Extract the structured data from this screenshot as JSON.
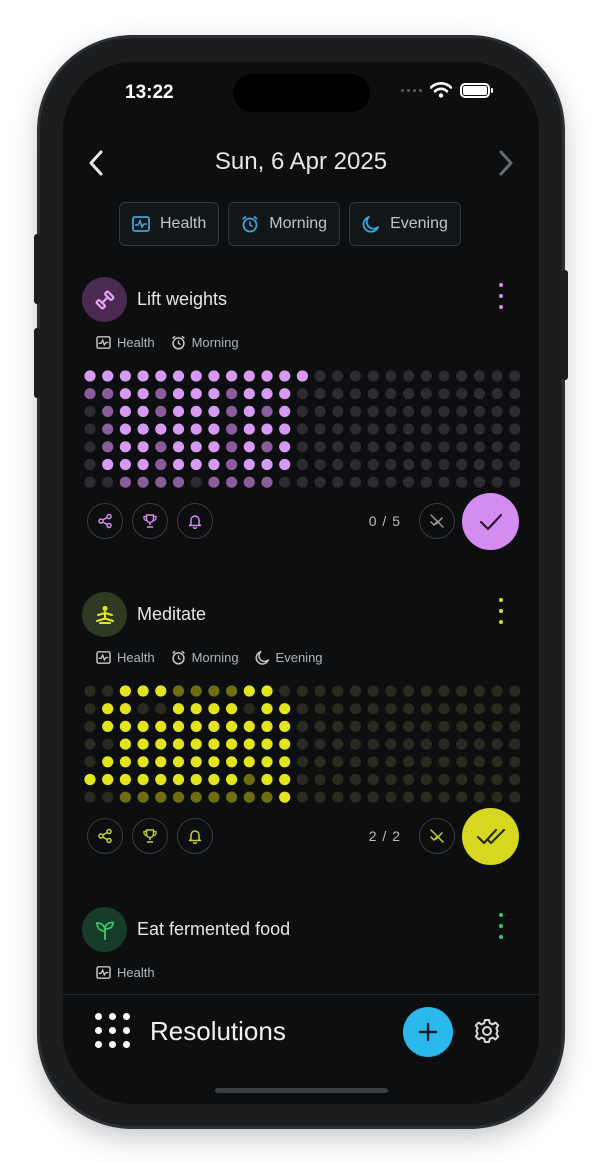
{
  "status": {
    "time": "13:22"
  },
  "header": {
    "date": "Sun, 6 Apr 2025"
  },
  "filters": [
    {
      "label": "Health",
      "icon": "health-icon"
    },
    {
      "label": "Morning",
      "icon": "alarm-icon"
    },
    {
      "label": "Evening",
      "icon": "moon-icon"
    }
  ],
  "cards": [
    {
      "title": "Lift weights",
      "icon": "dumbbell-icon",
      "color": "#d58cf0",
      "tags": [
        "Health",
        "Morning"
      ],
      "progress": "0 / 5",
      "done_icon": "check-icon",
      "grid_rows": [
        "...#####.#######..#######.......................",
        "...##########.##..##..##........................",
        "...##..######.##..##..##........................",
        "...##..##..##.##..##..##........................",
        "...##..##..######.##..##.......................",
        "...##..##..##.##..##..##.......................",
        "........##.#########..........................."
      ]
    },
    {
      "title": "Meditate",
      "icon": "meditate-icon",
      "color": "#e6e526",
      "tags": [
        "Health",
        "Morning",
        "Evening"
      ],
      "progress": "2 / 2",
      "done_icon": "double-check-icon",
      "grid_rows": []
    },
    {
      "title": "Eat fermented food",
      "icon": "sprout-icon",
      "color": "#39c66a",
      "tags": [
        "Health"
      ]
    }
  ],
  "bottom_bar": {
    "title": "Resolutions",
    "accent": "#2bb9ec"
  }
}
